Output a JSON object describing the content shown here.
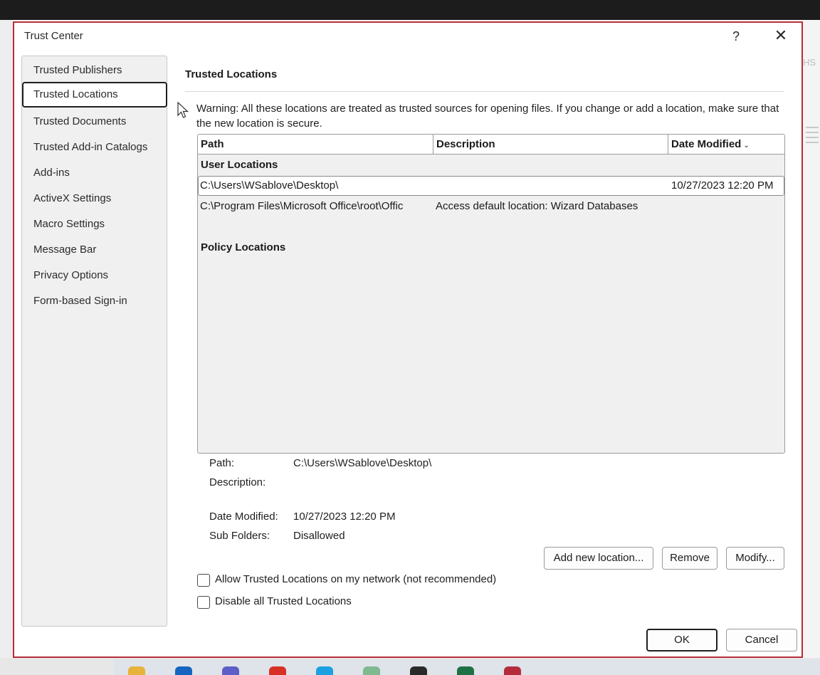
{
  "window": {
    "title": "Trust Center",
    "help_glyph": "?",
    "close_glyph": "✕"
  },
  "nav": {
    "items": [
      {
        "label": "Trusted Publishers",
        "selected": false
      },
      {
        "label": "Trusted Locations",
        "selected": true
      },
      {
        "label": "Trusted Documents",
        "selected": false
      },
      {
        "label": "Trusted Add-in Catalogs",
        "selected": false
      },
      {
        "label": "Add-ins",
        "selected": false
      },
      {
        "label": "ActiveX Settings",
        "selected": false
      },
      {
        "label": "Macro Settings",
        "selected": false
      },
      {
        "label": "Message Bar",
        "selected": false
      },
      {
        "label": "Privacy Options",
        "selected": false
      },
      {
        "label": "Form-based Sign-in",
        "selected": false
      }
    ]
  },
  "main": {
    "section_title": "Trusted Locations",
    "warning": "Warning: All these locations are treated as trusted sources for opening files.  If you change or add a location, make sure that the new location is secure.",
    "list": {
      "columns": {
        "path": "Path",
        "description": "Description",
        "date_modified": "Date Modified",
        "sort_glyph": "⌄"
      },
      "user_locations_label": "User Locations",
      "policy_locations_label": "Policy Locations",
      "rows": [
        {
          "path": "C:\\Users\\WSablove\\Desktop\\",
          "description": "",
          "date_modified": "10/27/2023 12:20 PM",
          "selected": true
        },
        {
          "path": "C:\\Program Files\\Microsoft Office\\root\\Offic",
          "description": "Access default location: Wizard Databases",
          "date_modified": "",
          "selected": false
        }
      ]
    },
    "details": {
      "path_label": "Path:",
      "path_value": "C:\\Users\\WSablove\\Desktop\\",
      "description_label": "Description:",
      "description_value": "",
      "date_modified_label": "Date Modified:",
      "date_modified_value": "10/27/2023 12:20 PM",
      "sub_folders_label": "Sub Folders:",
      "sub_folders_value": "Disallowed"
    },
    "buttons": {
      "add_new": "Add new location...",
      "remove": "Remove",
      "modify": "Modify..."
    },
    "options": {
      "allow_network": {
        "label": "Allow Trusted Locations on my network (not recommended)",
        "checked": false
      },
      "disable_all": {
        "label": "Disable all Trusted Locations",
        "checked": false
      }
    }
  },
  "footer": {
    "ok": "OK",
    "cancel": "Cancel"
  },
  "background": {
    "right_edge_text": "HS"
  },
  "colors": {
    "dialog_border": "#b52d3a",
    "nav_background": "#f0f0f0",
    "list_background": "#f0f0f0"
  }
}
